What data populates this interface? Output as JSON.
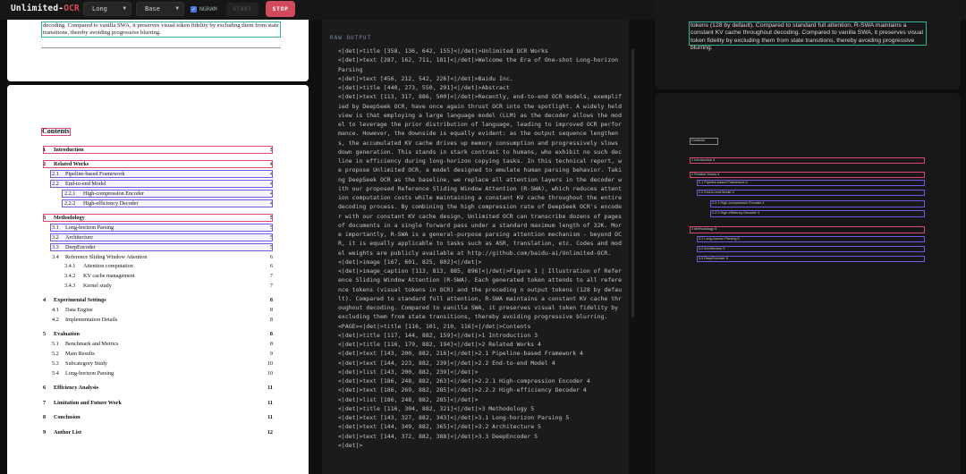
{
  "toolbar": {
    "brand_main": "Unlimited-",
    "brand_accent": "OCR",
    "mode_value": "Long",
    "size_value": "Base",
    "ngram_label": "NGRAM",
    "ngram_checked": true,
    "start_label": "START",
    "stop_label": "STOP"
  },
  "colors": {
    "accent": "#d04a5c",
    "box_title": "#d94a72",
    "box_text": "#6a5be0",
    "box_caption": "#33b39a"
  },
  "page1": {
    "caption_text": "decoding. Compared to vanilla SWA, it preserves visual token fidelity by excluding them from state transitions, thereby avoiding progressive blurring."
  },
  "toc": {
    "title": "Contents",
    "rows": [
      {
        "num": "1",
        "label": "Introduction",
        "page": "3"
      },
      {
        "num": "2",
        "label": "Related Works",
        "page": "4"
      },
      {
        "num": "2.1",
        "label": "Pipeline-based Framework",
        "page": "4"
      },
      {
        "num": "2.2",
        "label": "End-to-end Model",
        "page": "4"
      },
      {
        "num": "2.2.1",
        "label": "High-compression Encoder",
        "page": "4"
      },
      {
        "num": "2.2.2",
        "label": "High-efficiency Decoder",
        "page": "4"
      },
      {
        "num": "3",
        "label": "Methodology",
        "page": "5"
      },
      {
        "num": "3.1",
        "label": "Long-horizon Parsing",
        "page": "5"
      },
      {
        "num": "3.2",
        "label": "Architecture",
        "page": "5"
      },
      {
        "num": "3.3",
        "label": "DeepEncoder",
        "page": "5"
      },
      {
        "num": "3.4",
        "label": "Reference Sliding Window Attention",
        "page": "6"
      },
      {
        "num": "3.4.1",
        "label": "Attention computation",
        "page": "6"
      },
      {
        "num": "3.4.2",
        "label": "KV cache management",
        "page": "7"
      },
      {
        "num": "3.4.3",
        "label": "Kernel study",
        "page": "7"
      },
      {
        "num": "4",
        "label": "Experimental Settings",
        "page": "8"
      },
      {
        "num": "4.1",
        "label": "Data Engine",
        "page": "8"
      },
      {
        "num": "4.2",
        "label": "Implementation Details",
        "page": "8"
      },
      {
        "num": "5",
        "label": "Evaluation",
        "page": "8"
      },
      {
        "num": "5.1",
        "label": "Benchmark and Metrics",
        "page": "8"
      },
      {
        "num": "5.2",
        "label": "Main Results",
        "page": "9"
      },
      {
        "num": "5.3",
        "label": "Subcategory Study",
        "page": "10"
      },
      {
        "num": "5.4",
        "label": "Long-horizon Parsing",
        "page": "10"
      },
      {
        "num": "6",
        "label": "Efficiency Analysis",
        "page": "11"
      },
      {
        "num": "7",
        "label": "Limitation and Future Work",
        "page": "11"
      },
      {
        "num": "8",
        "label": "Conclusion",
        "page": "11"
      },
      {
        "num": "9",
        "label": "Author List",
        "page": "12"
      }
    ]
  },
  "raw_output": {
    "heading": "RAW OUTPUT",
    "text": "<|det|>title [358, 136, 642, 155]<|/det|>Unlimited OCR Works\n<|det|>text [287, 162, 711, 181]<|/det|>Welcome the Era of One-shot Long-horizon Parsing\n<|det|>text [456, 212, 542, 226]<|/det|>Baidu Inc.\n<|det|>title [440, 273, 550, 291]<|/det|>Abstract\n<|det|>text [113, 317, 886, 500]<|/det|>Recently, end-to-end OCR models, exemplified by DeepSeek OCR, have once again thrust OCR into the spotlight. A widely held view is that employing a large language model (LLM) as the decoder allows the model to leverage the prior distribution of language, leading to improved OCR performance. However, the downside is equally evident: as the output sequence lengthens, the accumulated KV cache drives up memory consumption and progressively slows down generation. This stands in stark contrast to humans, who exhibit no such decline in efficiency during long-horizon copying tasks. In this technical report, we propose Unlimited OCR, a model designed to emulate human parsing behavior. Taking DeepSeek OCR as the baseline, we replace all attention layers in the decoder with our proposed Reference Sliding Window Attention (R-SWA), which reduces attention computation costs while maintaining a constant KV cache throughout the entire decoding process. By combining the high compression rate of DeepSeek OCR's encoder with our constant KV cache design, Unlimited OCR can transcribe dozens of pages of documents in a single forward pass under a standard maximum length of 32K. More importantly, R-SWA is a general-purpose parsing attention mechanism - beyond OCR, it is equally applicable to tasks such as ASR, translation, etc. Codes and model weights are publicly available at http://github.com/baidu-ai/Unlimited-OCR.\n<|det|>image [167, 601, 825, 802]<|/det|>\n<|det|>image_caption [113, 813, 885, 896]<|/det|>Figure 1 | Illustration of Reference Sliding Window Attention (R-SWA). Each generated token attends to all reference tokens (visual tokens in OCR) and the preceding n output tokens (128 by default). Compared to standard full attention, R-SWA maintains a constant KV cache throughout decoding. Compared to vanilla SWA, it preserves visual token fidelity by excluding them from state transitions, thereby avoiding progressive blurring.\n<PAGE><|det|>title [116, 101, 210, 116]<|/det|>Contents\n<|det|>title [117, 144, 882, 159]<|/det|>1 Introduction 3\n<|det|>title [116, 179, 882, 194]<|/det|>2 Related Works 4\n<|det|>text [143, 200, 882, 216]<|/det|>2.1 Pipeline-based Framework 4\n<|det|>text [144, 223, 882, 239]<|/det|>2.2 End-to-end Model 4\n<|det|>list [143, 200, 882, 239]<|/det|>\n<|det|>text [186, 248, 882, 263]<|/det|>2.2.1 High-compression Encoder 4\n<|det|>text [186, 269, 882, 285]<|/det|>2.2.2 High-efficiency Decoder 4\n<|det|>list [186, 248, 882, 285]<|/det|>\n<|det|>title [116, 304, 882, 321]<|/det|>3 Methodology 5\n<|det|>text [143, 327, 882, 343]<|/det|>3.1 Long-horizon Parsing 5\n<|det|>text [144, 349, 882, 365]<|/det|>3.2 Architecture 5\n<|det|>text [144, 372, 882, 388]<|/det|>3.3 DeepEncoder 5\n<|det|>"
  },
  "right_top": {
    "caption_text": "tokens (128 by default). Compared to standard full attention, R-SWA maintains a constant KV cache throughout decoding. Compared to vanilla SWA, it preserves visual token fidelity by excluding them from state transitions, thereby avoiding progressive blurring."
  },
  "overlay_boxes": [
    {
      "kind": "gry",
      "label": "Contents"
    },
    {
      "kind": "red",
      "label": "1 Introduction 3"
    },
    {
      "kind": "red",
      "label": "2 Related Works 4"
    },
    {
      "kind": "blu",
      "label": "2.1 Pipeline-based Framework 4"
    },
    {
      "kind": "blu",
      "label": "2.2 End-to-end Model 4"
    },
    {
      "kind": "blu",
      "label": "2.2.1 High-compression Encoder 4"
    },
    {
      "kind": "blu",
      "label": "2.2.2 High-efficiency Decoder 4"
    },
    {
      "kind": "red",
      "label": "3 Methodology 5"
    },
    {
      "kind": "blu",
      "label": "3.1 Long-horizon Parsing 5"
    },
    {
      "kind": "blu",
      "label": "3.2 Architecture 5"
    },
    {
      "kind": "blu",
      "label": "3.3 DeepEncoder 5"
    }
  ]
}
